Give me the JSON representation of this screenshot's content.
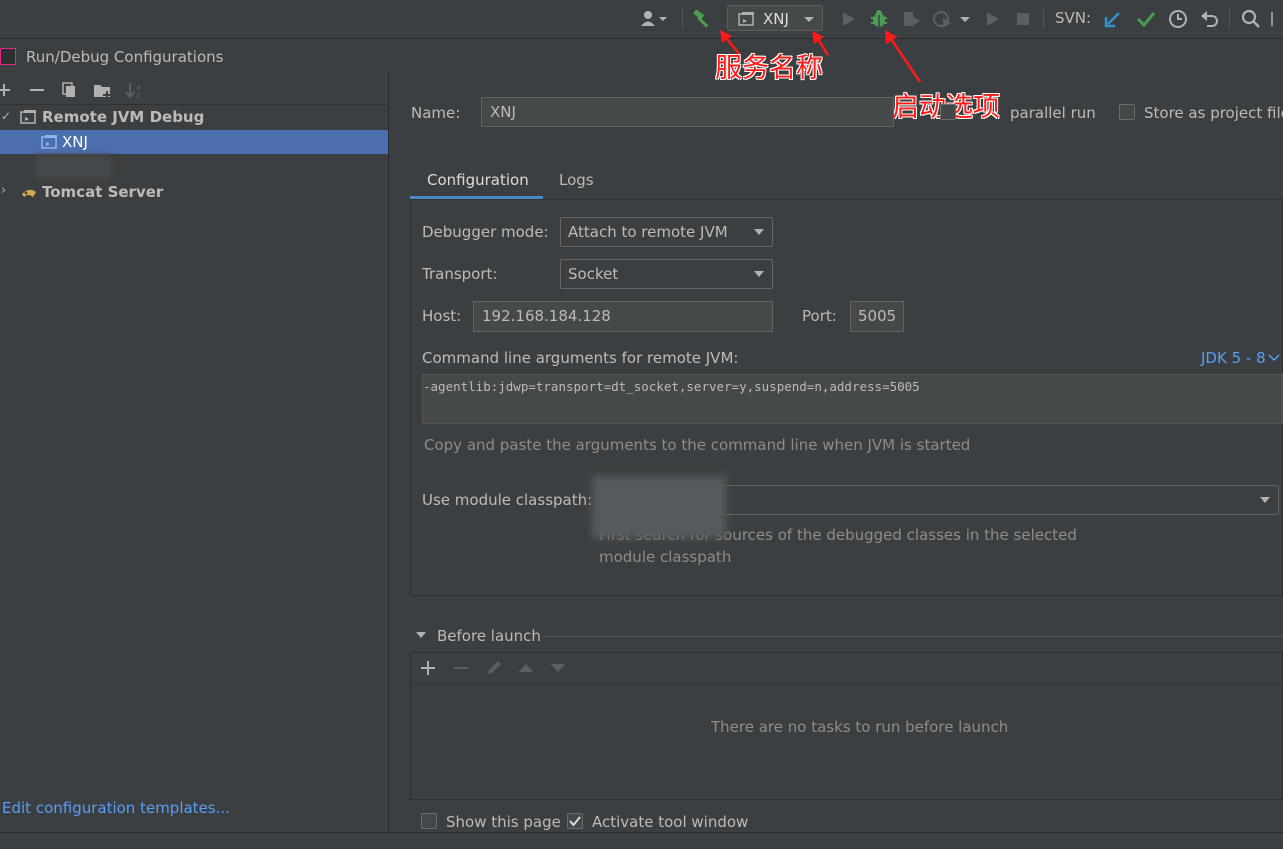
{
  "toolbar": {
    "run_config_name": "XNJ",
    "svn_label": "SVN:",
    "icons": [
      "user-icon",
      "build-hammer-icon",
      "run-config-icon",
      "run-icon",
      "debug-bug-icon",
      "coverage-icon",
      "profile-icon",
      "run-anything-icon",
      "stop-icon",
      "svn-update-icon",
      "svn-commit-icon",
      "history-icon",
      "revert-icon",
      "search-icon"
    ],
    "colors": {
      "hammer": "#4c9e4c",
      "bug": "#499c54",
      "svn_update": "#3592c4",
      "svn_commit": "#499c54"
    }
  },
  "annotations": {
    "service_name": "服务名称",
    "launch_option": "启动选项",
    "color": "#ff1a1a"
  },
  "dialog": {
    "title": "Run/Debug Configurations"
  },
  "tree": {
    "items": [
      {
        "label": "Remote JVM Debug",
        "expanded": true,
        "bold": true
      },
      {
        "label": "XNJ",
        "selected": true
      },
      {
        "label": "Tomcat Server",
        "expanded": false,
        "bold": true
      }
    ],
    "footer_link": "Edit configuration templates..."
  },
  "form": {
    "name_label": "Name:",
    "name_value": "XNJ",
    "allow_parallel_label": "parallel run",
    "store_as_project_label": "Store as project file",
    "tabs": [
      "Configuration",
      "Logs"
    ],
    "active_tab": "Configuration",
    "debugger_mode_label": "Debugger mode:",
    "debugger_mode_value": "Attach to remote JVM",
    "transport_label": "Transport:",
    "transport_value": "Socket",
    "host_label": "Host:",
    "host_value": "192.168.184.128",
    "port_label": "Port:",
    "port_value": "5005",
    "cmd_args_label": "Command line arguments for remote JVM:",
    "jdk_selector": "JDK 5 - 8",
    "cmd_args_value": "-agentlib:jdwp=transport=dt_socket,server=y,suspend=n,address=5005",
    "cmd_args_hint": "Copy and paste the arguments to the command line when JVM is started",
    "module_classpath_label": "Use module classpath:",
    "module_classpath_hint_line1": "First search for sources of the debugged classes in the selected",
    "module_classpath_hint_line2": "module classpath",
    "before_launch_title": "Before launch",
    "before_launch_empty": "There are no tasks to run before launch",
    "show_this_page_label": "Show this page",
    "show_this_page_checked": false,
    "activate_tool_window_label": "Activate tool window",
    "activate_tool_window_checked": true
  },
  "theme": {
    "accent": "#4b6eaf",
    "link": "#589df6",
    "tab_underline": "#4a88c7"
  }
}
